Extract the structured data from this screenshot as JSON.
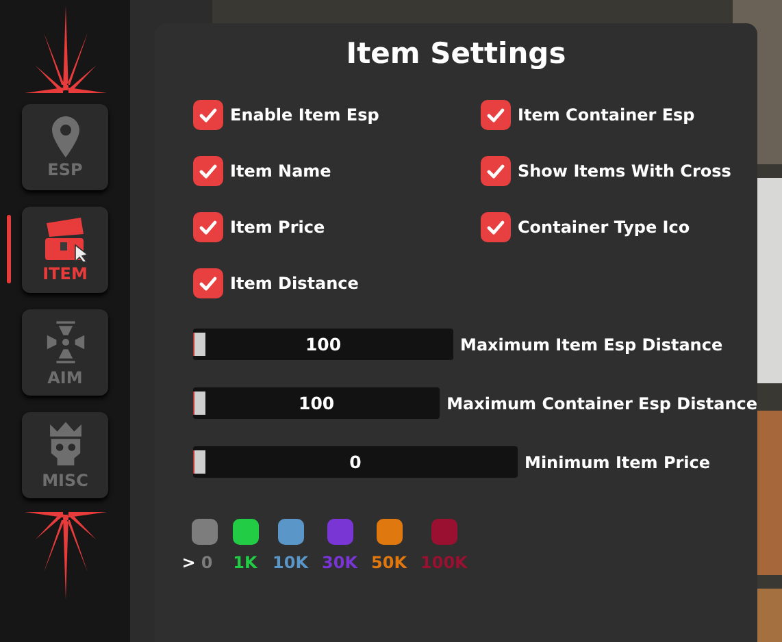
{
  "sidebar": {
    "items": [
      {
        "label": "ESP",
        "kind": "pin",
        "selected": false
      },
      {
        "label": "ITEM",
        "kind": "chest",
        "selected": true
      },
      {
        "label": "AIM",
        "kind": "crosshair",
        "selected": false
      },
      {
        "label": "MISC",
        "kind": "skull",
        "selected": false
      }
    ]
  },
  "panel": {
    "title": "Item Settings",
    "checkboxes": [
      {
        "label": "Enable Item Esp",
        "checked": true
      },
      {
        "label": "Item Container Esp",
        "checked": true
      },
      {
        "label": "Item Name",
        "checked": true
      },
      {
        "label": "Show Items With Cross",
        "checked": true
      },
      {
        "label": "Item Price",
        "checked": true
      },
      {
        "label": "Container Type Ico",
        "checked": true
      },
      {
        "label": "Item Distance",
        "checked": true
      }
    ],
    "sliders": [
      {
        "label": "Maximum Item Esp Distance",
        "value": "100",
        "level": 0
      },
      {
        "label": "Maximum Container Esp Distance",
        "value": "100",
        "level": 0
      },
      {
        "label": "Minimum Item Price",
        "value": "0",
        "level": 0
      }
    ],
    "legend": {
      "prefix": ">",
      "items": [
        {
          "label": "0",
          "color": "#7d7d7d"
        },
        {
          "label": "1K",
          "color": "#22cc44"
        },
        {
          "label": "10K",
          "color": "#5a96c8"
        },
        {
          "label": "30K",
          "color": "#7a35d5"
        },
        {
          "label": "50K",
          "color": "#e07810"
        },
        {
          "label": "100K",
          "color": "#9a1030"
        }
      ]
    }
  }
}
